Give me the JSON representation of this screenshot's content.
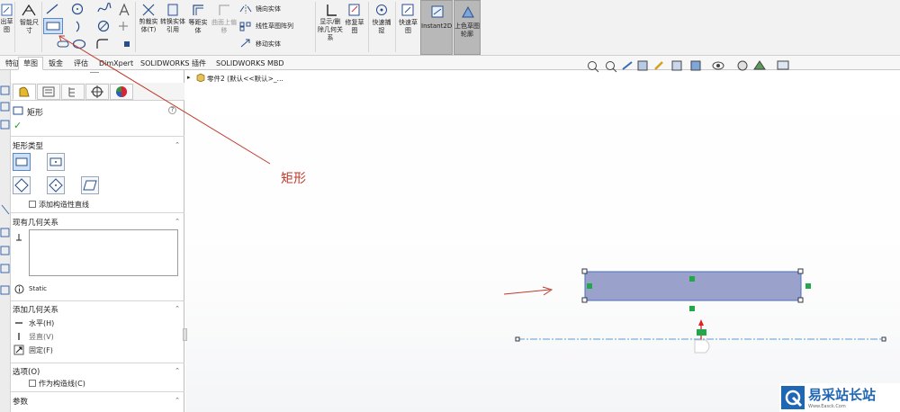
{
  "ribbon": {
    "exit_sketch": "出草图",
    "smart_dim": "智能尺寸",
    "trim": "剪裁实体(T)",
    "convert": "转换实体引用",
    "offset": "等距实体",
    "surface_offset": "曲面上偏移",
    "mirror": "镜向实体",
    "linear_pattern": "线性草图阵列",
    "move": "移动实体",
    "display_delete": "显示/删除几何关系",
    "repair": "修复草图",
    "quick_snap": "快速捕捉",
    "rapid_sketch": "快速草图",
    "instant2d": "Instant2D",
    "shaded": "上色草图轮廓"
  },
  "tabs": [
    "特征",
    "草图",
    "钣金",
    "评估",
    "DimXpert",
    "SOLIDWORKS 插件",
    "SOLIDWORKS MBD"
  ],
  "active_tab": "草图",
  "tree_label": "零件2 (默认<<默认>_...",
  "pm": {
    "title": "矩形",
    "help": "?",
    "ok": "✓",
    "rect_type_header": "矩形类型",
    "add_construction": "添加构造性直线",
    "existing_rel_header": "现有几何关系",
    "status": "Static",
    "add_rel_header": "添加几何关系",
    "rel_horizontal": "水平(H)",
    "rel_vertical": "竖直(V)",
    "rel_fix": "固定(F)",
    "options_header": "选项(O)",
    "as_construction": "作为构造线(C)",
    "params_header": "参数"
  },
  "annotation": {
    "text": "矩形",
    "color": "#c0392b"
  },
  "watermark": {
    "text": "易采站长站",
    "sub": "Www.Easck.Com"
  },
  "colors": {
    "accent": "#2b6cc4",
    "sketch_fill": "#9aa2cc",
    "sketch_edge": "#4a6fc4",
    "relation": "#22a84a",
    "centerline": "#5a9ad6"
  }
}
